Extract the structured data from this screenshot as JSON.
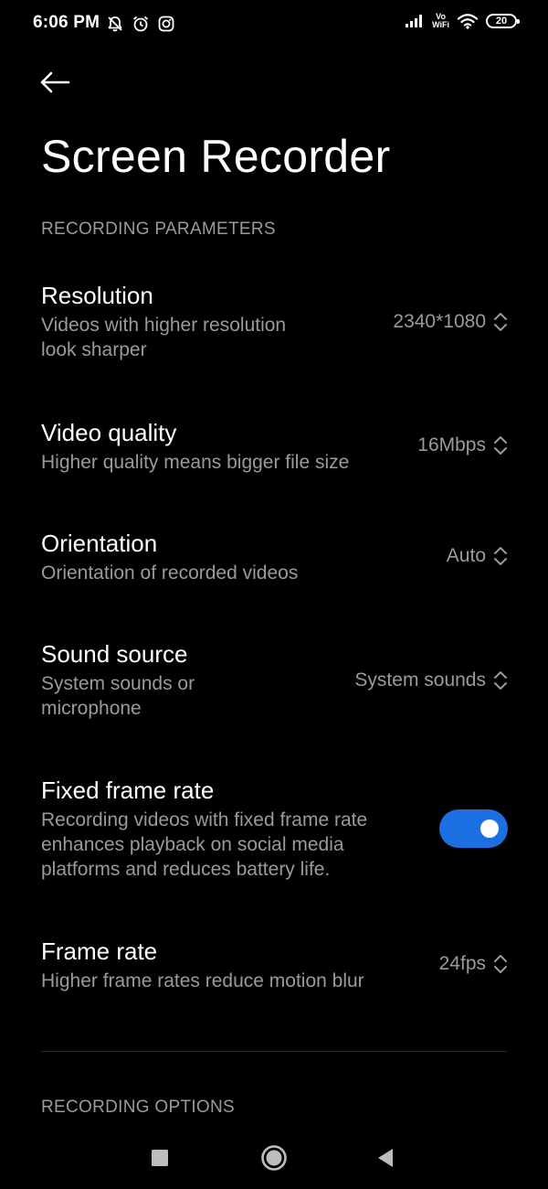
{
  "status_bar": {
    "time": "6:06 PM",
    "left_icons": [
      "notifications-off-icon",
      "alarm-icon",
      "instagram-icon"
    ],
    "vowifi_top": "Vo",
    "vowifi_bottom": "WiFi",
    "battery_level": "20"
  },
  "header": {
    "back_icon": "arrow-left-icon",
    "title": "Screen Recorder"
  },
  "sections": {
    "recording_parameters": "RECORDING PARAMETERS",
    "recording_options": "RECORDING OPTIONS"
  },
  "settings": {
    "resolution": {
      "title": "Resolution",
      "desc_line1": "Videos with higher resolution",
      "desc_line2": "look sharper",
      "value": "2340*1080"
    },
    "video_quality": {
      "title": "Video quality",
      "desc_line1": "Higher quality means bigger file size",
      "value": "16Mbps"
    },
    "orientation": {
      "title": "Orientation",
      "desc_line1": "Orientation of recorded videos",
      "value": "Auto"
    },
    "sound_source": {
      "title": "Sound source",
      "desc_line1": "System sounds or",
      "desc_line2": "microphone",
      "value": "System sounds"
    },
    "fixed_frame_rate": {
      "title": "Fixed frame rate",
      "desc_line1": "Recording videos with fixed frame rate",
      "desc_line2": "enhances playback on social media",
      "desc_line3": "platforms and reduces battery life.",
      "enabled": true
    },
    "frame_rate": {
      "title": "Frame rate",
      "desc_line1": "Higher frame rates reduce motion blur",
      "value": "24fps"
    }
  },
  "nav_bar": {
    "icons": [
      "recents-square-icon",
      "home-circle-icon",
      "back-triangle-icon"
    ]
  },
  "colors": {
    "background": "#000000",
    "text_primary": "#ffffff",
    "text_secondary": "#9a9a9a",
    "toggle_on": "#1c6fe0"
  }
}
